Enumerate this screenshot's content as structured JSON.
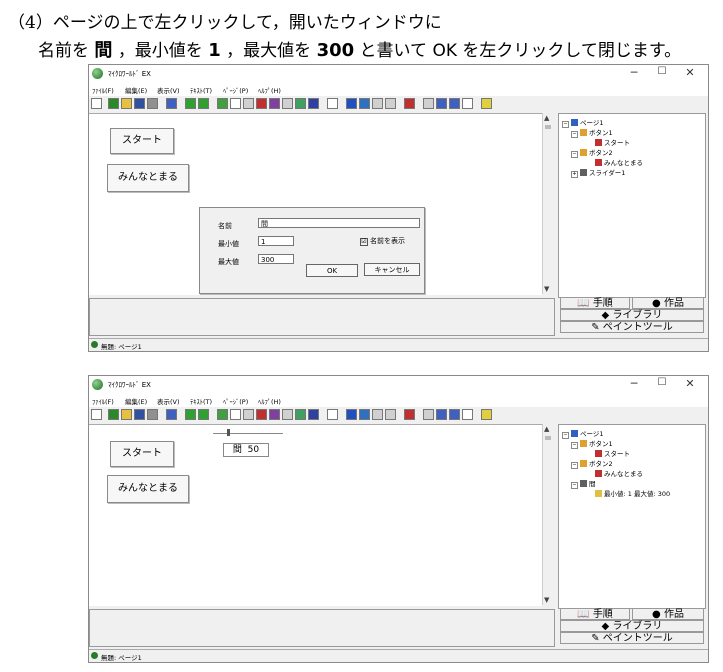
{
  "instructions": {
    "line1": "（4）ページの上で左クリックして，開いたウィンドウに",
    "line2_a": "名前を",
    "line2_name": "間",
    "line2_b": "，最小値を",
    "line2_min": "1",
    "line2_c": "，最大値を",
    "line2_max": "300",
    "line2_d": "と書いて",
    "line2_ok": "OK",
    "line2_e": "を左クリックして閉じます。"
  },
  "app": {
    "title": "ﾏｲｸﾛﾜｰﾙﾄﾞ EX",
    "window_controls": {
      "minimize": "─",
      "maximize": "☐",
      "close": "✕"
    },
    "menus": [
      "ﾌｧｲﾙ(F)",
      "編集(E)",
      "表示(V)",
      "ﾃｷｽﾄ(T)",
      "ﾍﾟｰｼﾞ(P)",
      "ﾍﾙﾌﾟ(H)"
    ],
    "status": "無題: ページ1",
    "tabs": {
      "procedure": "手順",
      "works": "作品",
      "library": "ライブラリ",
      "paint": "ペイントツール"
    }
  },
  "window1": {
    "buttons": {
      "start": "スタート",
      "together": "みんなとまる"
    },
    "dialog": {
      "name_label": "名前",
      "name_value": "間",
      "min_label": "最小値",
      "min_value": "1",
      "max_label": "最大値",
      "max_value": "300",
      "show_name": "名前を表示",
      "show_name_checked": "☑",
      "ok": "OK",
      "cancel": "キャンセル"
    },
    "tree": {
      "page": "ページ1",
      "button1": "ボタン1",
      "start": "スタート",
      "button2": "ボタン2",
      "together": "みんなとまる",
      "slider": "スライダー1"
    }
  },
  "window2": {
    "buttons": {
      "start": "スタート",
      "together": "みんなとまる"
    },
    "slider": {
      "name": "間",
      "value": "50"
    },
    "tree": {
      "page": "ページ1",
      "button1": "ボタン1",
      "start": "スタート",
      "button2": "ボタン2",
      "together": "みんなとまる",
      "slider": "間",
      "range": "最小値: 1  最大値: 300"
    }
  },
  "colors": {
    "window_bg": "#f0f0f0",
    "canvas": "#ffffff",
    "app_icon": "#1e6f2a"
  }
}
